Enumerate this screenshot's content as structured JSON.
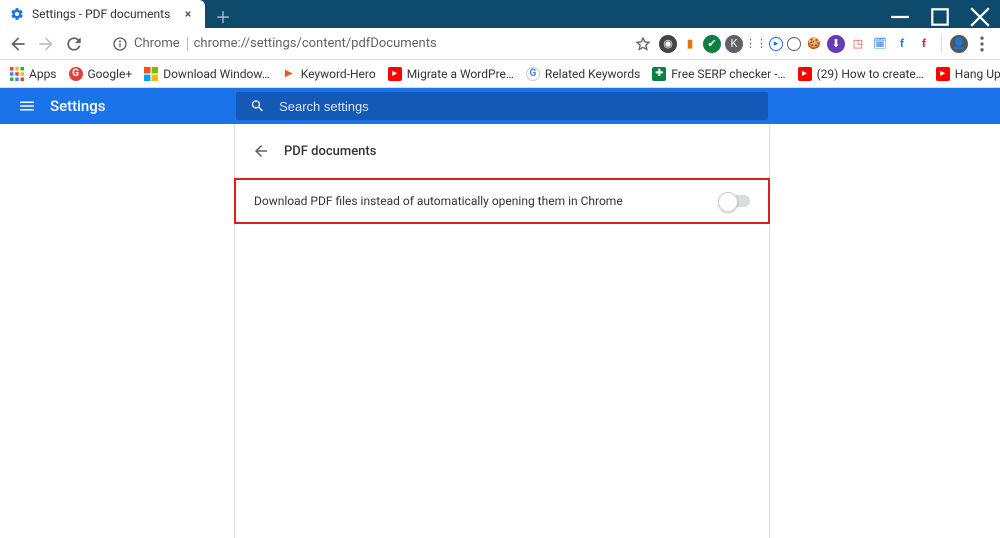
{
  "window": {
    "tab_title": "Settings - PDF documents"
  },
  "omnibox": {
    "chip": "Chrome",
    "url": "chrome://settings/content/pdfDocuments"
  },
  "bookmarks": [
    {
      "icon": "apps",
      "label": "Apps"
    },
    {
      "icon": "google-plus",
      "label": "Google+"
    },
    {
      "icon": "ms",
      "label": "Download Window…"
    },
    {
      "icon": "kh",
      "label": "Keyword-Hero"
    },
    {
      "icon": "yt",
      "label": "Migrate a WordPre…"
    },
    {
      "icon": "g",
      "label": "Related Keywords"
    },
    {
      "icon": "serp",
      "label": "Free SERP checker -…"
    },
    {
      "icon": "yt",
      "label": "(29) How to create…"
    },
    {
      "icon": "yt",
      "label": "Hang Ups (Want Yo…"
    }
  ],
  "settings": {
    "title": "Settings",
    "search_placeholder": "Search settings",
    "section_title": "PDF documents",
    "toggle_label": "Download PDF files instead of automatically opening them in Chrome"
  }
}
